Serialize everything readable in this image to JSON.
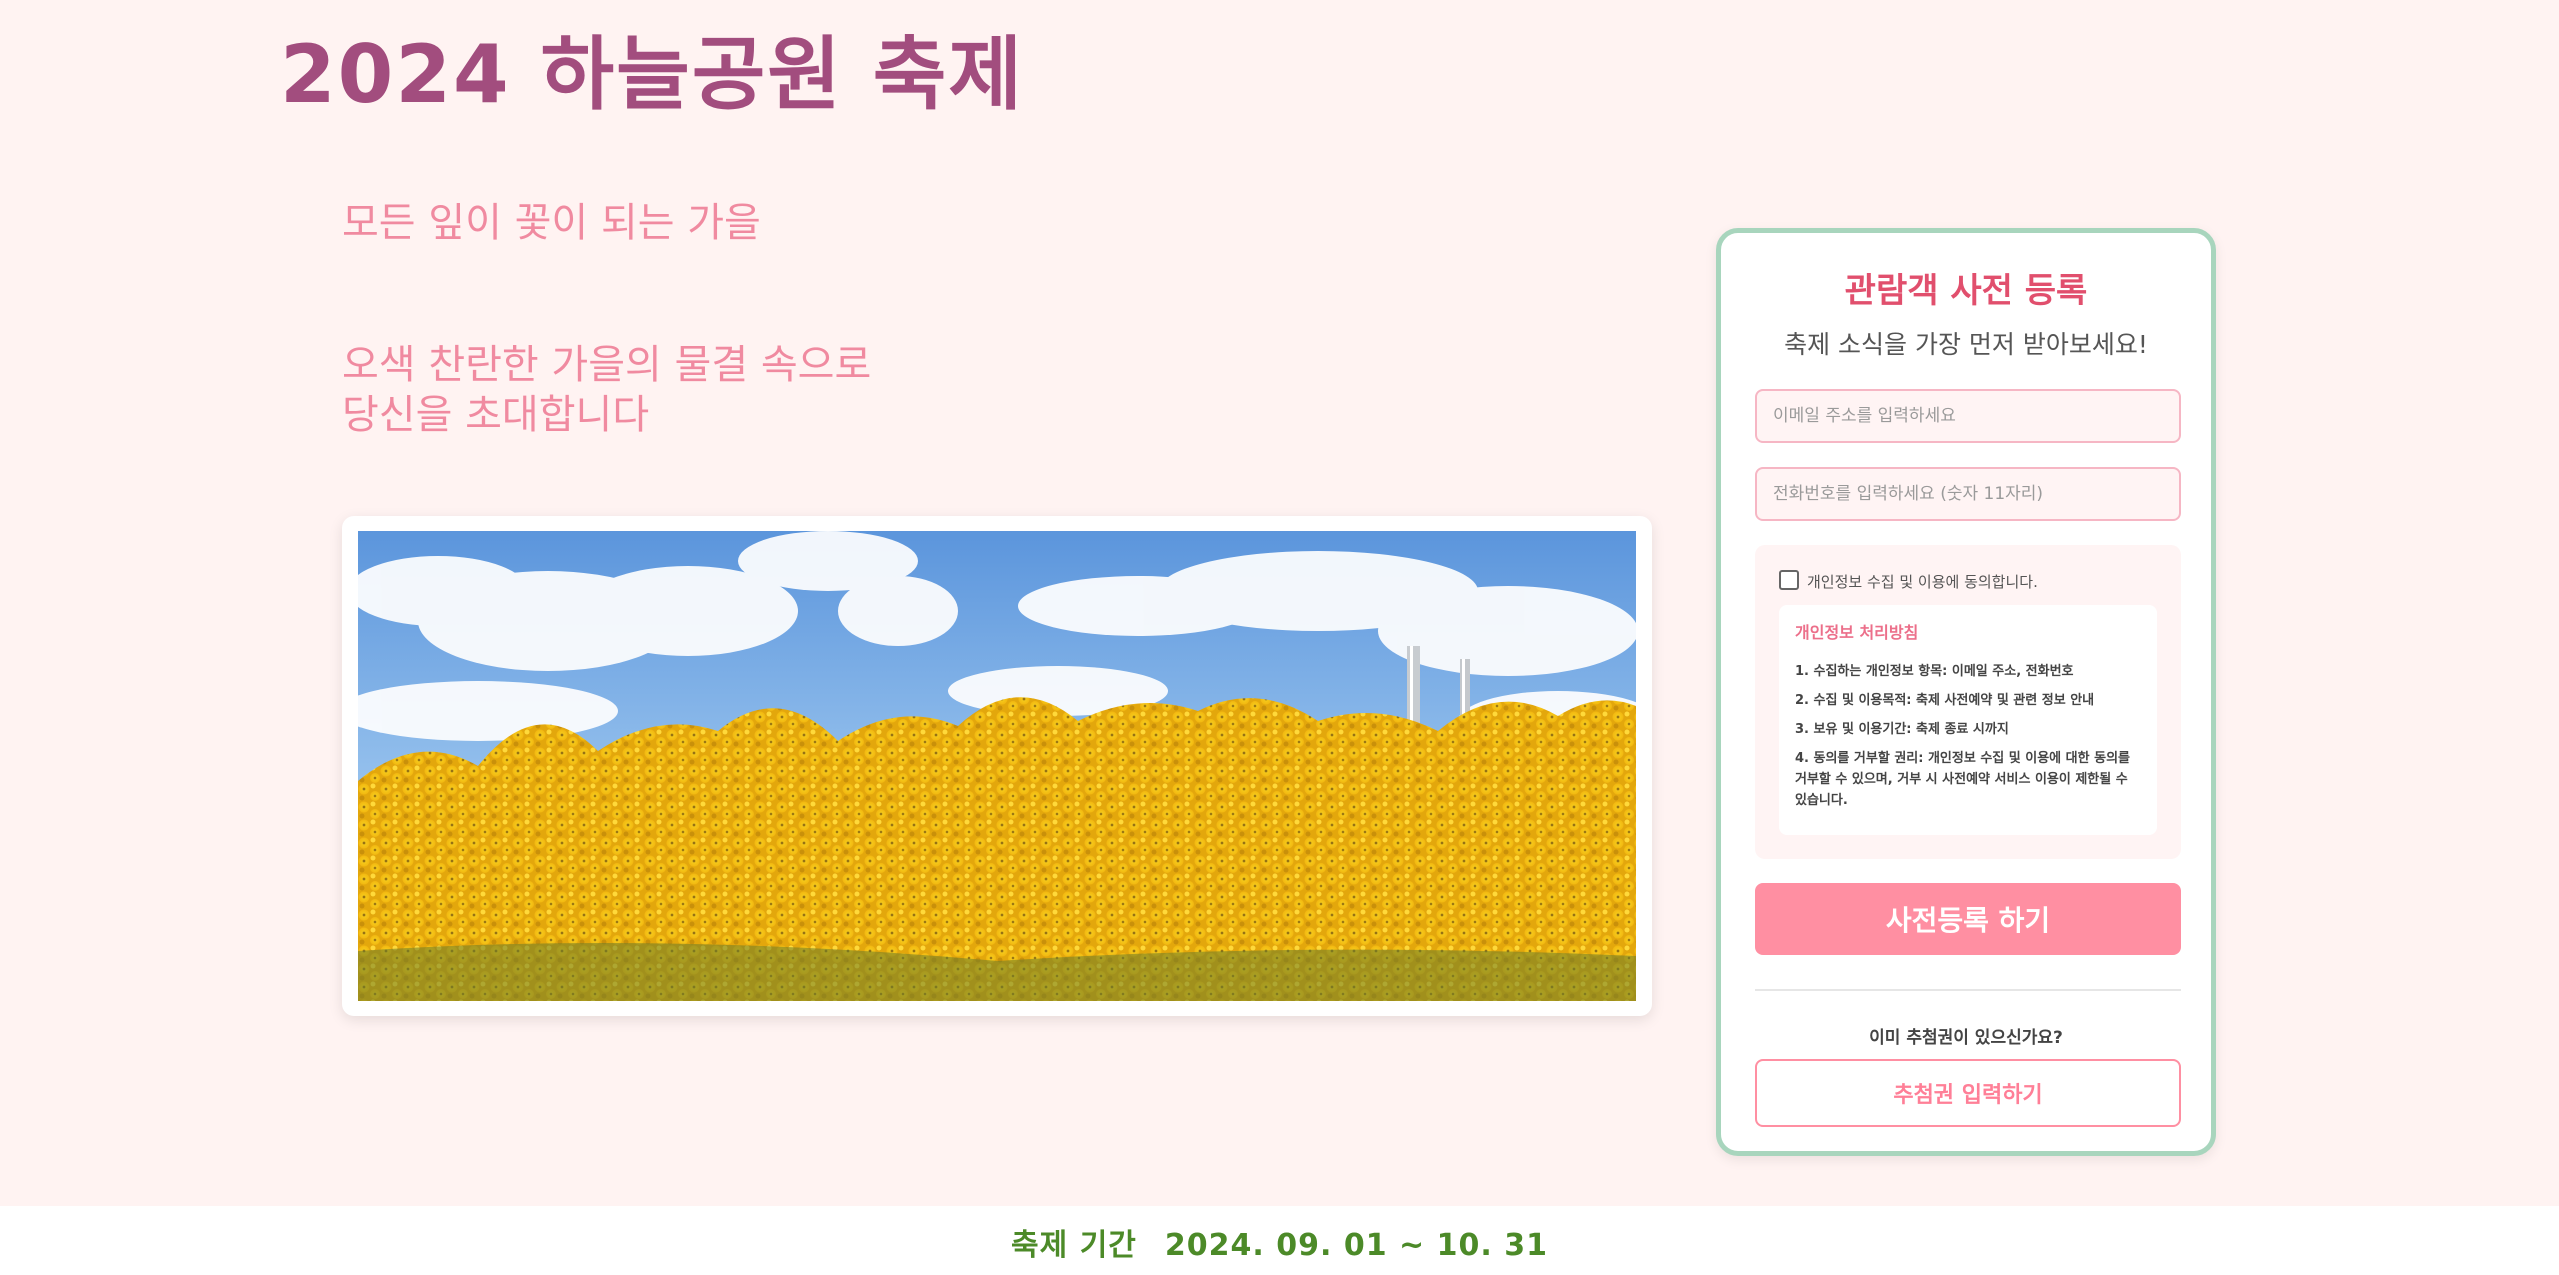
{
  "header": {
    "title": "2024 하늘공원 축제"
  },
  "hero": {
    "tagline": "모든 잎이 꽃이 되는 가을",
    "invite_line1": "오색 찬란한 가을의 물결 속으로",
    "invite_line2": "당신을 초대합니다"
  },
  "registration": {
    "title": "관람객 사전 등록",
    "subtitle": "축제 소식을 가장 먼저 받아보세요!",
    "email_placeholder": "이메일 주소를 입력하세요",
    "phone_placeholder": "전화번호를 입력하세요 (숫자 11자리)",
    "consent_label": "개인정보 수집 및 이용에 동의합니다.",
    "consent_checked": false,
    "policy": {
      "title": "개인정보 처리방침",
      "items": [
        "1. 수집하는 개인정보 항목: 이메일 주소, 전화번호",
        "2. 수집 및 이용목적: 축제 사전예약 및 관련 정보 안내",
        "3. 보유 및 이용기간: 축제 종료 시까지",
        "4. 동의를 거부할 권리: 개인정보 수집 및 이용에 대한 동의를 거부할 수 있으며, 거부 시 사전예약 서비스 이용이 제한될 수 있습니다."
      ]
    },
    "register_button": "사전등록 하기",
    "ticket_question": "이미 추첨권이 있으신가요?",
    "ticket_button": "추첨권 입력하기"
  },
  "footer": {
    "period_label": "축제 기간",
    "period_value": "2024. 09. 01 ~ 10. 31"
  },
  "colors": {
    "background": "#fff3f2",
    "title": "#a24d7e",
    "accent_pink": "#ff8fa2",
    "card_border": "#a8d5bd",
    "footer_text": "#4c8a28"
  }
}
